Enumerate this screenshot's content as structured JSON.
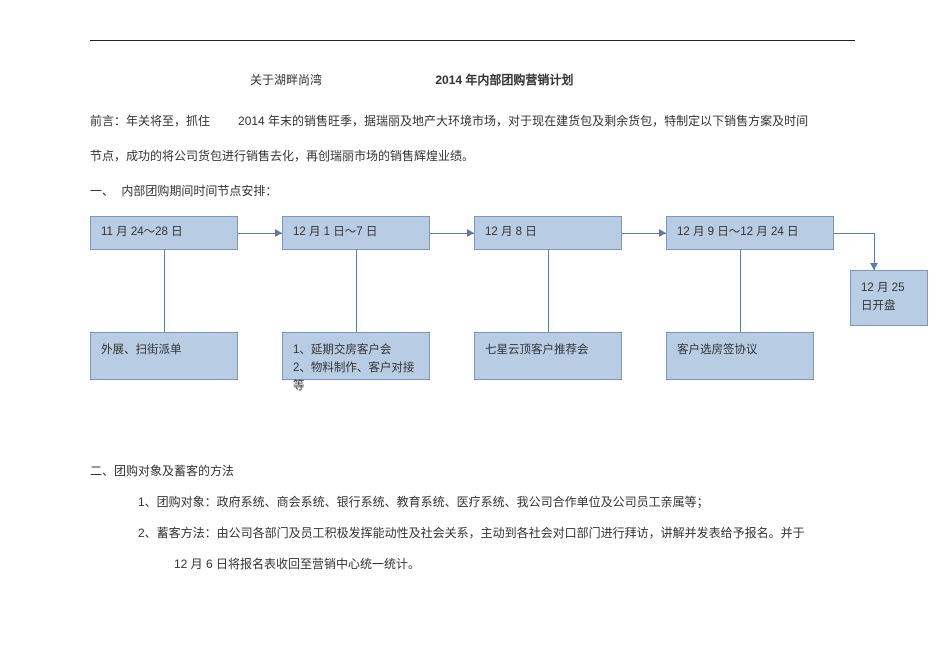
{
  "title": {
    "left": "关于湖畔尚湾",
    "right": "2014 年内部团购营销计划"
  },
  "preface": {
    "label": "前言：",
    "p1a": "年关将至，抓住",
    "p1b": "2014 年末的销售旺季，据瑞丽及地产大环境市场，对于现在建货包及剩余货包，特制定以下销售方案及时间",
    "p2": "节点，成功的将公司货包进行销售去化，再创瑞丽市场的销售辉煌业绩。"
  },
  "section1": {
    "num": "一、",
    "title": "内部团购期间时间节点安排："
  },
  "timeline": {
    "t1": "11 月 24～28 日",
    "t2": "12 月 1 日～7 日",
    "t3": "12 月 8 日",
    "t4": "12 月 9 日～12 月 24 日",
    "t5": "12 月 25 日开盘",
    "a1": "外展、扫街派单",
    "a2a": "1、延期交房客户会",
    "a2b": "2、物料制作、客户对接等",
    "a3": "七星云顶客户推荐会",
    "a4": "客户选房签协议"
  },
  "section2": {
    "heading": "二、团购对象及蓄客的方法",
    "item1": "1、团购对象：政府系统、商会系统、银行系统、教育系统、医疗系统、我公司合作单位及公司员工亲属等；",
    "item2": "2、蓄客方法：由公司各部门及员工积极发挥能动性及社会关系，主动到各社会对口部门进行拜访，讲解并发表给予报名。并于",
    "item2b": "12 月 6 日将报名表收回至营销中心统一统计。"
  }
}
